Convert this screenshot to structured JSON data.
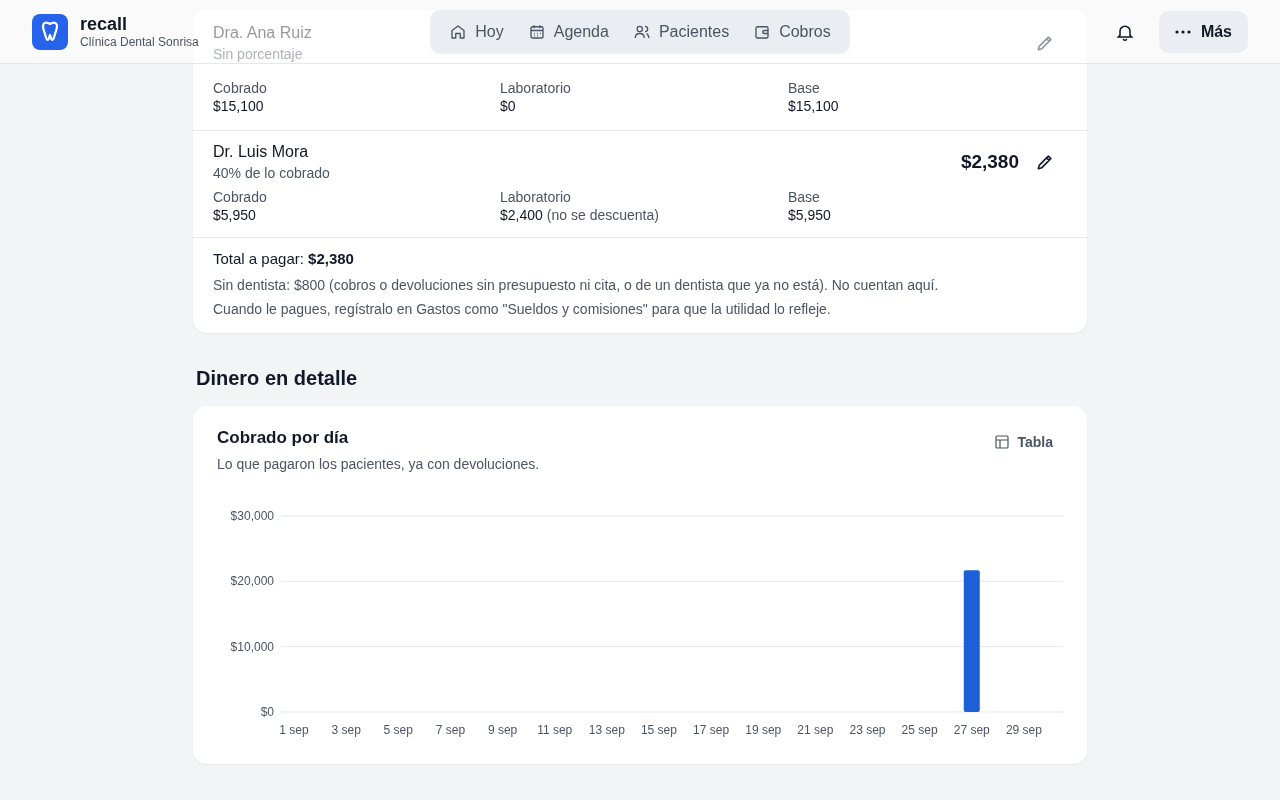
{
  "brand": {
    "name": "recall",
    "clinic": "Clínica Dental Sonrisa"
  },
  "nav": [
    {
      "label": "Hoy",
      "selected": false
    },
    {
      "label": "Agenda",
      "selected": false
    },
    {
      "label": "Pacientes",
      "selected": false
    },
    {
      "label": "Cobros",
      "selected": false
    }
  ],
  "more_button": "Más",
  "dentists": [
    {
      "name": "Dra. Ana Ruiz",
      "rule": "Sin porcentaje",
      "cobrado_label": "Cobrado",
      "cobrado": "$15,100",
      "lab_label": "Laboratorio",
      "lab": "$0",
      "base_label": "Base",
      "base": "$15,100"
    },
    {
      "name": "Dr. Luis Mora",
      "rule": "40% de lo cobrado",
      "amount": "$2,380",
      "cobrado_label": "Cobrado",
      "cobrado": "$5,950",
      "lab_label": "Laboratorio",
      "lab": "$2,400",
      "lab_note": "(no se descuenta)",
      "base_label": "Base",
      "base": "$5,950"
    }
  ],
  "total": "Total a pagar: **$2,380**",
  "notes": [
    "Sin dentista: $800 (cobros o devoluciones sin presupuesto ni cita, o de un dentista que ya no está). No cuentan aquí.",
    "Cuando le pagues, regístralo en Gastos como \"Sueldos y comisiones\" para que la utilidad lo refleje."
  ],
  "section_title": "Dinero en detalle",
  "chart_card": {
    "title": "Cobrado por día",
    "subtitle": "Lo que pagaron los pacientes, ya con devoluciones.",
    "table_button": "Tabla",
    "chart_data": {
      "type": "bar",
      "categories": [
        "1 sep",
        "3 sep",
        "5 sep",
        "7 sep",
        "9 sep",
        "11 sep",
        "13 sep",
        "15 sep",
        "17 sep",
        "19 sep",
        "21 sep",
        "23 sep",
        "25 sep",
        "27 sep",
        "29 sep"
      ],
      "values": [
        0,
        0,
        0,
        0,
        0,
        0,
        0,
        0,
        0,
        0,
        0,
        0,
        0,
        21700,
        0
      ],
      "ylim": [
        0,
        30000
      ],
      "yticks": [
        {
          "value": 0,
          "label": "$0"
        },
        {
          "value": 10000,
          "label": "$10,000"
        },
        {
          "value": 20000,
          "label": "$20,000"
        },
        {
          "value": 30000,
          "label": "$30,000"
        }
      ]
    }
  }
}
